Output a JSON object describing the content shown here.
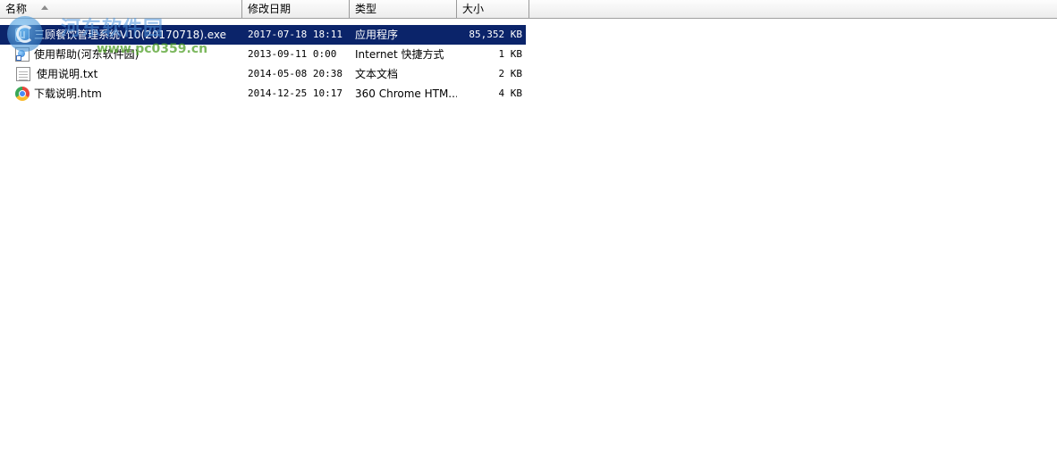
{
  "columns": {
    "name": "名称",
    "date": "修改日期",
    "type": "类型",
    "size": "大小"
  },
  "files": [
    {
      "name": "三顾餐饮管理系统V10(20170718).exe",
      "date": "2017-07-18 18:11",
      "type": "应用程序",
      "size": "85,352 KB",
      "icon": "app-icon",
      "selected": true
    },
    {
      "name": "使用帮助(河东软件园)",
      "date": "2013-09-11 0:00",
      "type": "Internet 快捷方式",
      "size": "1 KB",
      "icon": "internet-shortcut-icon",
      "selected": false
    },
    {
      "name": "使用说明.txt",
      "date": "2014-05-08 20:38",
      "type": "文本文档",
      "size": "2 KB",
      "icon": "text-file-icon",
      "selected": false
    },
    {
      "name": "下载说明.htm",
      "date": "2014-12-25 10:17",
      "type": "360 Chrome HTM...",
      "size": "4 KB",
      "icon": "chrome-html-icon",
      "selected": false
    }
  ],
  "watermark": {
    "title": "河东软件园",
    "url": "www.pc0359.cn"
  },
  "colors": {
    "selection": "#0b246a",
    "header_bg": "#ececec"
  }
}
